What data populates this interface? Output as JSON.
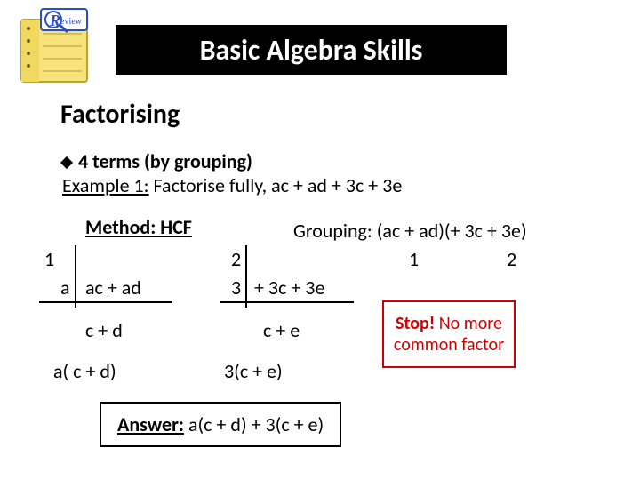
{
  "icon_alt": "Review",
  "title": "Basic Algebra Skills",
  "section": "Factorising",
  "bullet": "4 terms (by grouping)",
  "example_label": "Example 1:",
  "example_text": " Factorise fully, ac + ad + 3c + 3e",
  "method_label": "Method: HCF",
  "grouping_text": "Grouping: (ac + ad)(+ 3c + 3e)",
  "numbers": {
    "one_a": "1",
    "one_b": "1",
    "two_a": "2",
    "two_b": "2"
  },
  "work": {
    "a": "a",
    "acad": "ac + ad",
    "three": "3",
    "c3e": "+ 3c + 3e",
    "cd": "c + d",
    "ce": "c + e",
    "acd": "a( c + d)",
    "e3ce": "3(c + e)"
  },
  "stop_text_bold": "Stop!",
  "stop_text_rest": " No more common factor",
  "answer_label": "Answer:",
  "answer_rest": " a(c + d) + 3(c + e)"
}
